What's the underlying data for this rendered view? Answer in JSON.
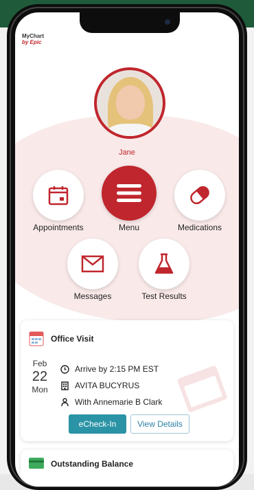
{
  "app": {
    "logo_line1": "MyChart",
    "logo_line2": "by Epic"
  },
  "user": {
    "name": "Jane"
  },
  "menu": [
    {
      "id": "appointments",
      "label": "Appointments",
      "icon": "calendar-icon"
    },
    {
      "id": "menu",
      "label": "Menu",
      "icon": "hamburger-menu-icon"
    },
    {
      "id": "medications",
      "label": "Medications",
      "icon": "pill-icon"
    },
    {
      "id": "messages",
      "label": "Messages",
      "icon": "envelope-icon"
    },
    {
      "id": "test_results",
      "label": "Test Results",
      "icon": "flask-icon"
    }
  ],
  "appointment": {
    "title": "Office Visit",
    "month": "Feb",
    "day": "22",
    "weekday": "Mon",
    "arrive": "Arrive by 2:15 PM EST",
    "location": "AVITA BUCYRUS",
    "provider": "With Annemarie B Clark",
    "checkin_label": "eCheck-In",
    "details_label": "View Details"
  },
  "balance": {
    "title": "Outstanding Balance"
  },
  "colors": {
    "brand_red": "#c0262d",
    "teal": "#2a93a5",
    "bg_pink": "#f9e9e9",
    "banner_green": "#1f5b3a"
  }
}
